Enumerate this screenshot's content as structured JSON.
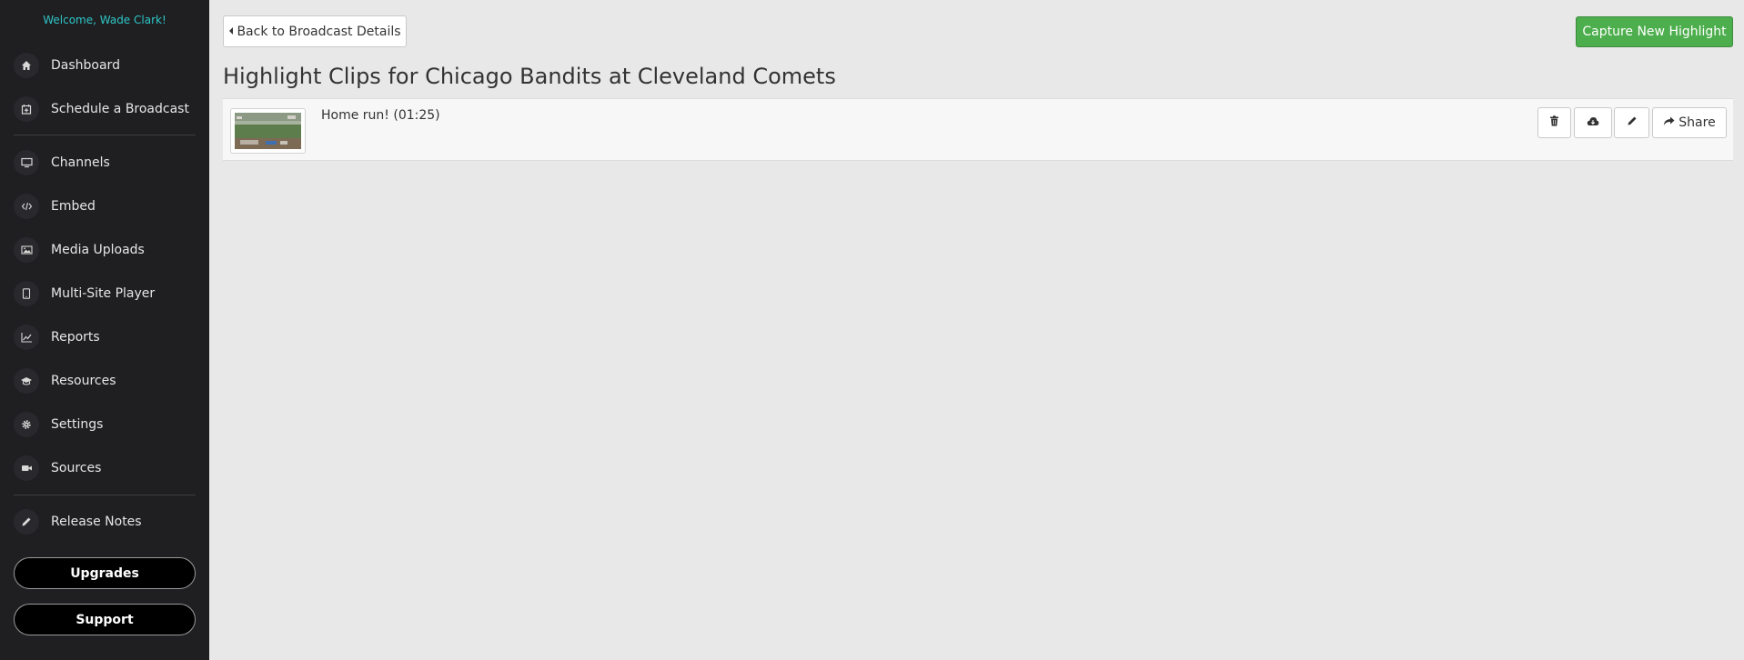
{
  "sidebar": {
    "welcome": "Welcome, Wade Clark!",
    "items": [
      {
        "label": "Dashboard",
        "icon": "home-icon"
      },
      {
        "label": "Schedule a Broadcast",
        "icon": "calendar-plus-icon"
      },
      {
        "label": "Channels",
        "icon": "monitor-icon"
      },
      {
        "label": "Embed",
        "icon": "code-icon"
      },
      {
        "label": "Media Uploads",
        "icon": "image-icon"
      },
      {
        "label": "Multi-Site Player",
        "icon": "tablet-icon"
      },
      {
        "label": "Reports",
        "icon": "line-chart-icon"
      },
      {
        "label": "Resources",
        "icon": "graduation-cap-icon"
      },
      {
        "label": "Settings",
        "icon": "gear-icon"
      },
      {
        "label": "Sources",
        "icon": "video-camera-icon"
      },
      {
        "label": "Release Notes",
        "icon": "pencil-icon"
      }
    ],
    "upgrades_label": "Upgrades",
    "support_label": "Support"
  },
  "header": {
    "back_label": "Back to Broadcast Details",
    "capture_label": "Capture New Highlight"
  },
  "main": {
    "title": "Highlight Clips for Chicago Bandits at Cleveland Comets",
    "clips": [
      {
        "title": "Home run! (01:25)",
        "share_label": "Share"
      }
    ]
  },
  "colors": {
    "sidebar_bg": "#1f1f22",
    "welcome": "#2dc6c6",
    "page_bg": "#e8e8e8",
    "capture_green": "#4cae4c"
  }
}
